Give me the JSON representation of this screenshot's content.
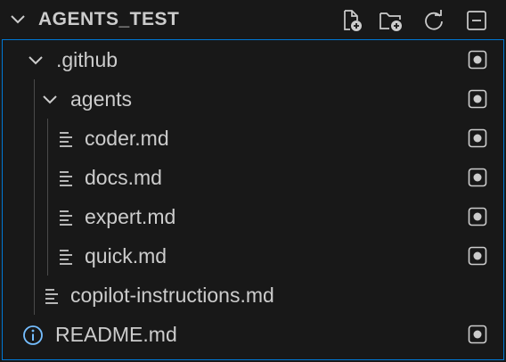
{
  "header": {
    "title": "AGENTS_TEST",
    "actions": [
      {
        "name": "new-file",
        "icon": "new-file-icon"
      },
      {
        "name": "new-folder",
        "icon": "new-folder-icon"
      },
      {
        "name": "refresh",
        "icon": "refresh-icon"
      },
      {
        "name": "collapse-all",
        "icon": "collapse-all-icon"
      }
    ]
  },
  "tree": {
    "github_folder": ".github",
    "agents_folder": "agents",
    "files": {
      "coder": "coder.md",
      "docs": "docs.md",
      "expert": "expert.md",
      "quick": "quick.md",
      "copilot": "copilot-instructions.md",
      "readme": "README.md"
    }
  },
  "colors": {
    "background": "#181818",
    "focus_border": "#0078d4",
    "text": "#cccccc",
    "info_icon": "#75beff",
    "indent_guide": "#4a4a4a"
  }
}
